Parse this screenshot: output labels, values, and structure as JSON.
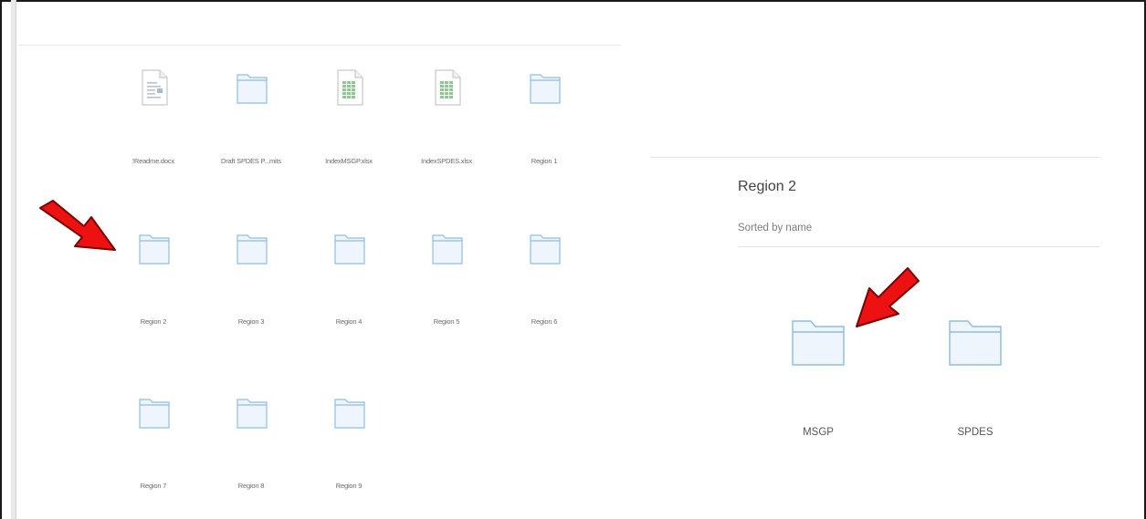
{
  "left_panel": {
    "items": [
      {
        "label": "!Readme.docx",
        "icon": "word-document-icon"
      },
      {
        "label": "Draft SPDES P...mits",
        "icon": "folder-icon"
      },
      {
        "label": "IndexMSGP.xlsx",
        "icon": "spreadsheet-icon"
      },
      {
        "label": "IndexSPDES.xlsx",
        "icon": "spreadsheet-icon"
      },
      {
        "label": "Region 1",
        "icon": "folder-icon"
      },
      {
        "label": "Region 2",
        "icon": "folder-icon"
      },
      {
        "label": "Region 3",
        "icon": "folder-icon"
      },
      {
        "label": "Region 4",
        "icon": "folder-icon"
      },
      {
        "label": "Region 5",
        "icon": "folder-icon"
      },
      {
        "label": "Region 6",
        "icon": "folder-icon"
      },
      {
        "label": "Region 7",
        "icon": "folder-icon"
      },
      {
        "label": "Region 8",
        "icon": "folder-icon"
      },
      {
        "label": "Region 9",
        "icon": "folder-icon"
      }
    ]
  },
  "right_panel": {
    "title": "Region 2",
    "sort_label": "Sorted by name",
    "items": [
      {
        "label": "MSGP",
        "icon": "folder-icon"
      },
      {
        "label": "SPDES",
        "icon": "folder-icon"
      }
    ]
  },
  "colors": {
    "folder_stroke": "#8fbde6",
    "folder_fill": "#eef5fc",
    "arrow_fill": "#ee1111",
    "arrow_stroke": "#7a0000",
    "sheet_green": "#4caf50"
  }
}
